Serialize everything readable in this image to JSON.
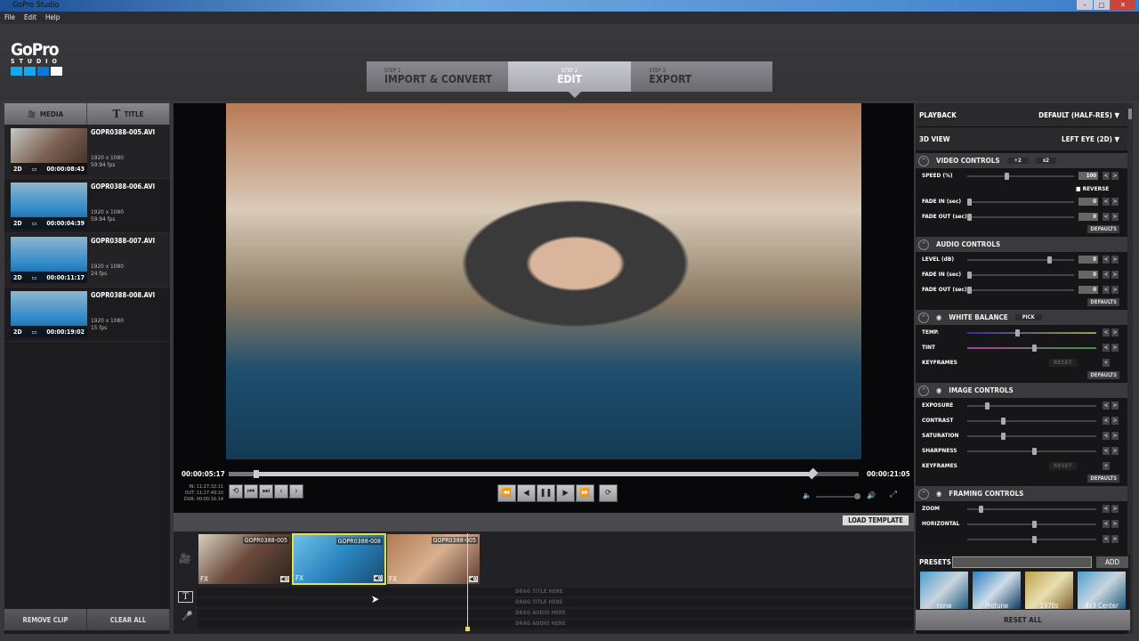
{
  "window": {
    "title": "GoPro Studio",
    "min": "–",
    "max": "□",
    "close": "✕"
  },
  "menu": [
    "File",
    "Edit",
    "Help"
  ],
  "logo": {
    "brand": "GoPro",
    "sub": "STUDIO"
  },
  "steps": [
    {
      "num": "STEP 1",
      "label": "IMPORT & CONVERT"
    },
    {
      "num": "STEP 2",
      "label": "EDIT",
      "active": true
    },
    {
      "num": "STEP 3",
      "label": "EXPORT"
    }
  ],
  "left": {
    "tabs": [
      "MEDIA",
      "TITLE"
    ],
    "media": [
      {
        "name": "GOPR0388-005.AVI",
        "mode": "2D",
        "duration": "00:00:08:43",
        "res": "1920 x 1080",
        "fps": "59.94 fps"
      },
      {
        "name": "GOPR0388-006.AVI",
        "mode": "2D",
        "duration": "00:00:04:39",
        "res": "1920 x 1080",
        "fps": "59.94 fps"
      },
      {
        "name": "GOPR0388-007.AVI",
        "mode": "2D",
        "duration": "00:00:11:17",
        "res": "1920 x 1080",
        "fps": "24 fps"
      },
      {
        "name": "GOPR0388-008.AVI",
        "mode": "2D",
        "duration": "00:00:19:02",
        "res": "1920 x 1080",
        "fps": "15 fps"
      }
    ],
    "remove": "REMOVE CLIP",
    "clear": "CLEAR ALL"
  },
  "player": {
    "current": "00:00:05:17",
    "total": "00:00:21:05",
    "in": "IN: 11:27:32:11",
    "out": "OUT: 11:27:49:10",
    "dur": "DUR: 00:00:16:14",
    "progress": 0.04
  },
  "timeline": {
    "load_template": "LOAD TEMPLATE",
    "clips": [
      {
        "name": "GOPR0388-005",
        "fx": "FX"
      },
      {
        "name": "GOPR0388-008",
        "fx": "FX",
        "selected": true
      },
      {
        "name": "GOPR0388-005",
        "fx": "FX"
      }
    ],
    "lanes": [
      "DRAG TITLE HERE",
      "DRAG TITLE HERE",
      "DRAG AUDIO HERE",
      "DRAG AUDIO HERE"
    ]
  },
  "right": {
    "playback": {
      "label": "PLAYBACK",
      "value": "DEFAULT (HALF-RES)"
    },
    "view3d": {
      "label": "3D VIEW",
      "value": "LEFT EYE (2D)"
    },
    "sections": [
      {
        "title": "VIDEO CONTROLS",
        "extra": [
          "÷2",
          "x2"
        ],
        "controls": [
          {
            "label": "SPEED (%)",
            "pos": 0.35,
            "value": "100"
          },
          {
            "label": "REVERSE",
            "checkbox": true
          },
          {
            "label": "FADE IN (sec)",
            "pos": 0,
            "value": "0"
          },
          {
            "label": "FADE OUT (sec)",
            "pos": 0,
            "value": "0"
          }
        ],
        "defaults": "DEFAULTS"
      },
      {
        "title": "AUDIO CONTROLS",
        "controls": [
          {
            "label": "LEVEL (dB)",
            "pos": 0.75,
            "value": "0"
          },
          {
            "label": "FADE IN (sec)",
            "pos": 0,
            "value": "0"
          },
          {
            "label": "FADE OUT (sec)",
            "pos": 0,
            "value": "0"
          }
        ],
        "defaults": "DEFAULTS"
      },
      {
        "title": "WHITE BALANCE",
        "eye": true,
        "extra": [
          "PICK"
        ],
        "controls": [
          {
            "label": "TEMP.",
            "pos": 0.37
          },
          {
            "label": "TINT",
            "pos": 0.5
          },
          {
            "label": "KEYFRAMES",
            "keyframes": "RESET"
          }
        ],
        "defaults": "DEFAULTS"
      },
      {
        "title": "IMAGE CONTROLS",
        "eye": true,
        "controls": [
          {
            "label": "EXPOSURE",
            "pos": 0.14
          },
          {
            "label": "CONTRAST",
            "pos": 0.26
          },
          {
            "label": "SATURATION",
            "pos": 0.26
          },
          {
            "label": "SHARPNESS",
            "pos": 0.5
          },
          {
            "label": "KEYFRAMES",
            "keyframes": "RESET"
          }
        ],
        "defaults": "DEFAULTS"
      },
      {
        "title": "FRAMING CONTROLS",
        "eye": true,
        "controls": [
          {
            "label": "ZOOM",
            "pos": 0.09
          },
          {
            "label": "HORIZONTAL",
            "pos": 0.5
          },
          {
            "label": "",
            "pos": 0.5
          }
        ]
      }
    ],
    "presets_label": "PRESETS",
    "add": "ADD",
    "presets": [
      "none",
      "Protune",
      "1970s",
      "4x3 Center"
    ],
    "reset_all": "RESET ALL"
  }
}
